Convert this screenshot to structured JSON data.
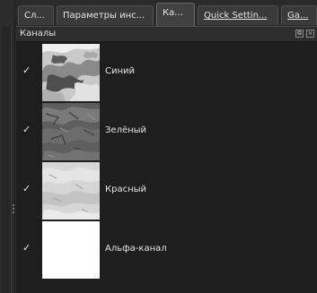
{
  "tabs": [
    {
      "label": "Сл...",
      "active": false,
      "underline": false
    },
    {
      "label": "Параметры инс...",
      "active": false,
      "underline": false
    },
    {
      "label": "Ка...",
      "active": true,
      "underline": false
    },
    {
      "label": "Quick Settin...",
      "active": false,
      "underline": true
    },
    {
      "label": "Ga...",
      "active": false,
      "underline": true
    }
  ],
  "panel": {
    "title": "Каналы",
    "header_icons": [
      "float-icon",
      "close-icon"
    ]
  },
  "channels": [
    {
      "name": "Синий",
      "visible": true,
      "check": "✓"
    },
    {
      "name": "Зелёный",
      "visible": true,
      "check": "✓"
    },
    {
      "name": "Красный",
      "visible": true,
      "check": "✓"
    },
    {
      "name": "Альфа-канал",
      "visible": true,
      "check": "✓"
    }
  ],
  "colors": {
    "panel_bg": "#1e1e1e",
    "tab_bg": "#3a3a3a",
    "text": "#e4e4e4"
  }
}
